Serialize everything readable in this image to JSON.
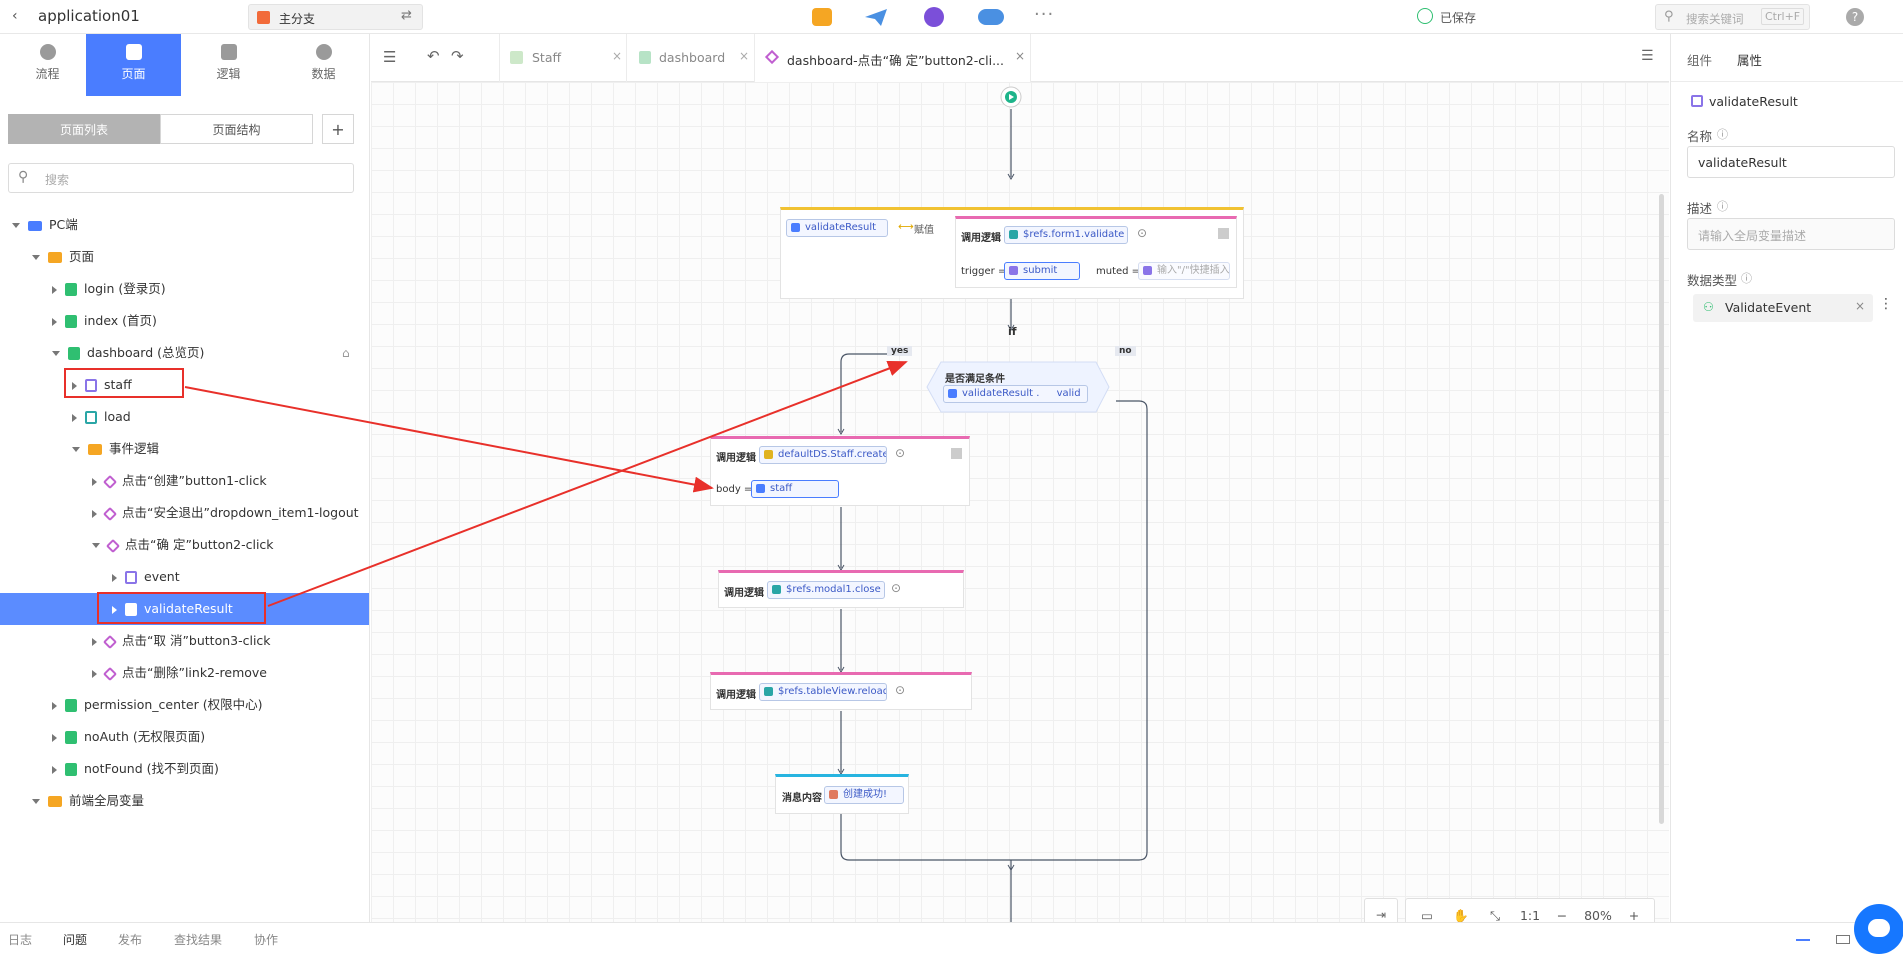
{
  "header": {
    "app_name": "application01",
    "branch": "主分支",
    "saved": "已保存",
    "search_placeholder": "搜索关键词",
    "search_shortcut": "Ctrl+F",
    "help": "?"
  },
  "left_tabs": [
    {
      "label": "流程"
    },
    {
      "label": "页面"
    },
    {
      "label": "逻辑"
    },
    {
      "label": "数据"
    }
  ],
  "page_list": {
    "seg_list": "页面列表",
    "seg_structure": "页面结构",
    "add": "+",
    "search_placeholder": "搜索"
  },
  "tree": [
    {
      "label": "PC端"
    },
    {
      "label": "页面"
    },
    {
      "label": "login (登录页)"
    },
    {
      "label": "index (首页)"
    },
    {
      "label": "dashboard (总览页)"
    },
    {
      "label": "staff"
    },
    {
      "label": "load"
    },
    {
      "label": "事件逻辑"
    },
    {
      "label": "点击“创建”button1-click"
    },
    {
      "label": "点击“安全退出”dropdown_item1-logout"
    },
    {
      "label": "点击“确 定”button2-click"
    },
    {
      "label": "event"
    },
    {
      "label": "validateResult"
    },
    {
      "label": "点击“取 消”button3-click"
    },
    {
      "label": "点击“删除”link2-remove"
    },
    {
      "label": "permission_center (权限中心)"
    },
    {
      "label": "noAuth (无权限页面)"
    },
    {
      "label": "notFound (找不到页面)"
    },
    {
      "label": "前端全局变量"
    }
  ],
  "editor_tabs": [
    {
      "label": "Staff"
    },
    {
      "label": "dashboard"
    },
    {
      "label": "dashboard-点击“确 定”button2-cli..."
    }
  ],
  "flow": {
    "assign_var": "validateResult",
    "assign_op": "赋值",
    "call_logic": "调用逻辑",
    "form_validate": "$refs.form1.validate",
    "trigger_label": "trigger =",
    "trigger_value": "submit",
    "muted_label": "muted =",
    "muted_placeholder": "输入\"/\"快捷插入",
    "if_label": "if",
    "yes": "yes",
    "no": "no",
    "cond_title": "是否满足条件",
    "cond_var": "validateResult .",
    "cond_prop": "valid",
    "create_logic": "defaultDS.Staff.create",
    "body_label": "body =",
    "body_value": "staff",
    "modal_close": "$refs.modal1.close",
    "table_reload": "$refs.tableView.reload",
    "message_label": "消息内容",
    "message_value": "创建成功!"
  },
  "zoom": {
    "ratio": "1:1",
    "minus": "−",
    "level": "80%",
    "plus": "+"
  },
  "right_panel": {
    "tab_components": "组件",
    "tab_properties": "属性",
    "var_name": "validateResult",
    "name_label": "名称",
    "name_value": "validateResult",
    "desc_label": "描述",
    "desc_placeholder": "请输入全局变量描述",
    "type_label": "数据类型",
    "type_value": "ValidateEvent"
  },
  "bottom_tabs": [
    {
      "label": "日志"
    },
    {
      "label": "问题"
    },
    {
      "label": "发布"
    },
    {
      "label": "查找结果"
    },
    {
      "label": "协作"
    }
  ],
  "colors": {
    "accent": "#4a7dff",
    "selected_row": "#5b8cff",
    "annotation": "#e8302a"
  }
}
